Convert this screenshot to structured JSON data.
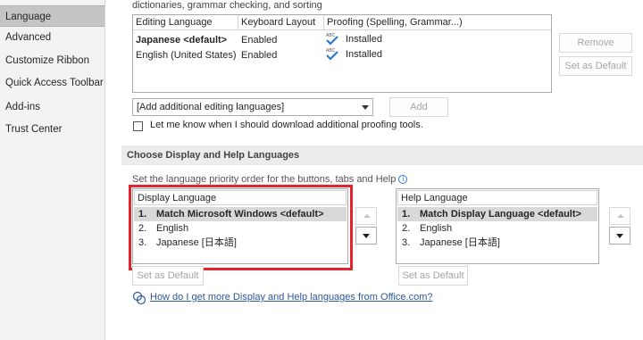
{
  "sidebar": {
    "items": [
      {
        "label": "Language",
        "selected": true
      },
      {
        "label": "Advanced"
      },
      {
        "label": "Customize Ribbon"
      },
      {
        "label": "Quick Access Toolbar"
      },
      {
        "label": "Add-ins"
      },
      {
        "label": "Trust Center"
      }
    ]
  },
  "editing": {
    "intro": "dictionaries, grammar checking, and sorting",
    "columns": [
      "Editing Language",
      "Keyboard Layout",
      "Proofing (Spelling, Grammar...)"
    ],
    "rows": [
      {
        "language": "Japanese <default>",
        "keyboard": "Enabled",
        "proofing": "Installed"
      },
      {
        "language": "English (United States)",
        "keyboard": "Enabled",
        "proofing": "Installed"
      }
    ],
    "proofing_icon_text": "ABC",
    "remove_label": "Remove",
    "set_default_label": "Set as Default",
    "add_combo_value": "[Add additional editing languages]",
    "add_label": "Add",
    "notify_checkbox_label": "Let me know when I should download additional proofing tools."
  },
  "display_help": {
    "section_title": "Choose Display and Help Languages",
    "instruction": "Set the language priority order for the buttons, tabs and Help",
    "display": {
      "header": "Display Language",
      "items": [
        {
          "num": "1.",
          "label": "Match Microsoft Windows <default>"
        },
        {
          "num": "2.",
          "label": "English"
        },
        {
          "num": "3.",
          "label": "Japanese [日本語]"
        }
      ],
      "set_default_label": "Set as Default"
    },
    "help": {
      "header": "Help Language",
      "items": [
        {
          "num": "1.",
          "label": "Match Display Language <default>"
        },
        {
          "num": "2.",
          "label": "English"
        },
        {
          "num": "3.",
          "label": "Japanese [日本語]"
        }
      ],
      "set_default_label": "Set as Default"
    },
    "more_link": "How do I get more Display and Help languages from Office.com?"
  },
  "colors": {
    "highlight": "#e4232c",
    "link": "#2b579a",
    "check_icon": "#2b7cd3"
  }
}
